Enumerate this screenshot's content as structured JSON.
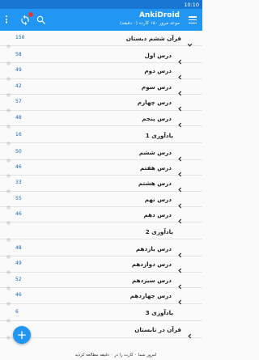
{
  "status_bar": {
    "time": "10:10"
  },
  "app_bar": {
    "title": "AnkiDroid",
    "subtitle": "موعد مرور ۱۵۰ کارت (۰ دقیقه)"
  },
  "decks": [
    {
      "name": "قرآن ششم دبستان",
      "count": "150",
      "level": 0,
      "expanded": true
    },
    {
      "name": "درس اول",
      "count": "58",
      "level": 1,
      "expandable": true
    },
    {
      "name": "درس دوم",
      "count": "49",
      "level": 1,
      "expandable": true
    },
    {
      "name": "درس سوم",
      "count": "42",
      "level": 1,
      "expandable": true
    },
    {
      "name": "درس چهارم",
      "count": "57",
      "level": 1,
      "expandable": true
    },
    {
      "name": "درس پنجم",
      "count": "48",
      "level": 1,
      "expandable": true
    },
    {
      "name": "یادآوری 1",
      "count": "16",
      "level": 1,
      "expandable": false
    },
    {
      "name": "درس ششم",
      "count": "50",
      "level": 1,
      "expandable": true
    },
    {
      "name": "درس هفتم",
      "count": "46",
      "level": 1,
      "expandable": true
    },
    {
      "name": "درس هشتم",
      "count": "33",
      "level": 1,
      "expandable": true
    },
    {
      "name": "درس نهم",
      "count": "55",
      "level": 1,
      "expandable": true
    },
    {
      "name": "درس دهم",
      "count": "46",
      "level": 1,
      "expandable": true
    },
    {
      "name": "یادآوری 2",
      "count": "",
      "level": 1,
      "expandable": false
    },
    {
      "name": "درس یازدهم",
      "count": "48",
      "level": 1,
      "expandable": true
    },
    {
      "name": "درس دوازدهم",
      "count": "49",
      "level": 1,
      "expandable": true
    },
    {
      "name": "درس سیزدهم",
      "count": "52",
      "level": 1,
      "expandable": true
    },
    {
      "name": "درس چهاردهم",
      "count": "46",
      "level": 1,
      "expandable": true
    },
    {
      "name": "یادآوری 3",
      "count": "6",
      "level": 1,
      "expandable": false
    },
    {
      "name": "قرآن در تابستان",
      "count": "",
      "level": 0,
      "expandable": true
    }
  ],
  "fab": {
    "icon": "plus-icon",
    "label": "+"
  },
  "footer": {
    "text": "امروز شما ۰ کارت را در ۰ دقیقه مطالعه کردید"
  },
  "colors": {
    "primary": "#2196f3",
    "status_bar": "#1976d2",
    "count": "#1565c0"
  }
}
